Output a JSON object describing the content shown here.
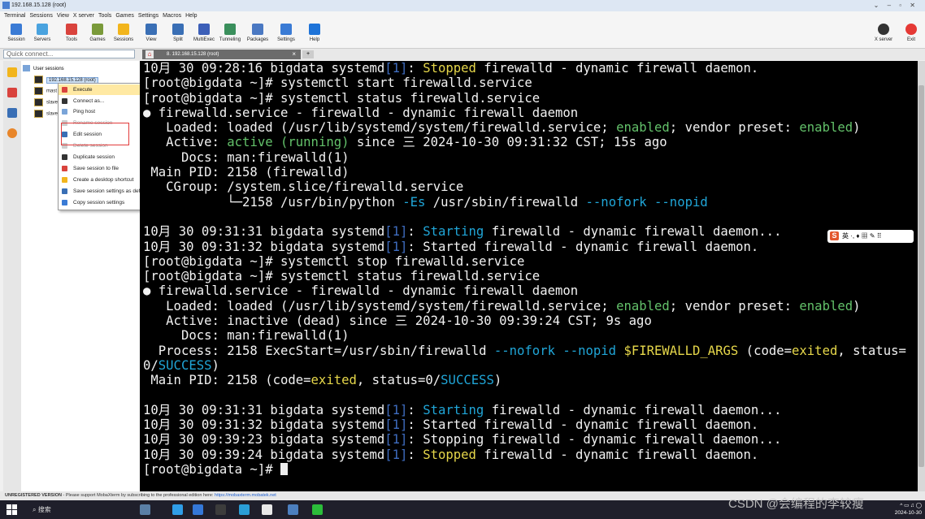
{
  "window": {
    "title": "192.168.15.128 (root)"
  },
  "menu": [
    "Terminal",
    "Sessions",
    "View",
    "X server",
    "Tools",
    "Games",
    "Settings",
    "Macros",
    "Help"
  ],
  "toolbar": {
    "left": [
      {
        "label": "Session",
        "icon": "session-icon",
        "color": "#3a7bd5"
      },
      {
        "label": "Servers",
        "icon": "servers-icon",
        "color": "#4aa3df"
      },
      {
        "label": "Tools",
        "icon": "tools-icon",
        "color": "#d9433d"
      },
      {
        "label": "Games",
        "icon": "games-icon",
        "color": "#7a9a3a"
      },
      {
        "label": "Sessions",
        "icon": "sessions-star-icon",
        "color": "#f2b51c"
      },
      {
        "label": "View",
        "icon": "view-icon",
        "color": "#3a6fb5"
      },
      {
        "label": "Split",
        "icon": "split-icon",
        "color": "#3a6fb5"
      },
      {
        "label": "MultiExec",
        "icon": "multiexec-icon",
        "color": "#3c5fb8"
      },
      {
        "label": "Tunneling",
        "icon": "tunneling-icon",
        "color": "#3a8f5c"
      },
      {
        "label": "Packages",
        "icon": "packages-icon",
        "color": "#4a78c2"
      },
      {
        "label": "Settings",
        "icon": "settings-icon",
        "color": "#3a7bd5"
      },
      {
        "label": "Help",
        "icon": "help-icon",
        "color": "#1e73d8"
      }
    ],
    "right": [
      {
        "label": "X server",
        "icon": "xserver-icon",
        "color": "#333333"
      },
      {
        "label": "Exit",
        "icon": "exit-icon",
        "color": "#e53935"
      }
    ]
  },
  "quick_connect": {
    "placeholder": "Quick connect..."
  },
  "tab": {
    "label": "8. 192.168.15.128 (root)",
    "close": "×"
  },
  "sidebar": {
    "root_label": "User sessions",
    "items": [
      "192.168.15.128 (root)",
      "mast",
      "slave",
      "slave"
    ]
  },
  "context_menu": [
    {
      "label": "Execute",
      "highlight": true,
      "disabled": false,
      "color": "#d9433d"
    },
    {
      "label": "Connect as...",
      "highlight": false,
      "disabled": false,
      "color": "#333333"
    },
    {
      "label": "Ping host",
      "highlight": false,
      "disabled": false,
      "color": "#7aa4d8"
    },
    {
      "label": "Rename session",
      "highlight": false,
      "disabled": true,
      "color": "#cccccc"
    },
    {
      "label": "Edit session",
      "highlight": false,
      "disabled": false,
      "color": "#3a6fb5"
    },
    {
      "label": "Delete session",
      "highlight": false,
      "disabled": true,
      "color": "#cccccc"
    },
    {
      "label": "Duplicate session",
      "highlight": false,
      "disabled": false,
      "color": "#333333"
    },
    {
      "label": "Save session to file",
      "highlight": false,
      "disabled": false,
      "color": "#d9433d"
    },
    {
      "label": "Create a desktop shortcut",
      "highlight": false,
      "disabled": false,
      "color": "#f2b51c"
    },
    {
      "label": "Save session settings as default presets",
      "highlight": false,
      "disabled": false,
      "color": "#3a6fb5"
    },
    {
      "label": "Copy session settings",
      "highlight": false,
      "disabled": false,
      "color": "#3a7bd5"
    }
  ],
  "terminal": {
    "lines": [
      [
        {
          "t": "10月 30 09:28:16 bigdata systemd"
        },
        {
          "t": "[1]",
          "c": "dim"
        },
        {
          "t": ": "
        },
        {
          "t": "Stopped",
          "c": "yellow"
        },
        {
          "t": " firewalld - dynamic firewall daemon."
        }
      ],
      [
        {
          "t": "[root@bigdata ~]# systemctl start firewalld.service"
        }
      ],
      [
        {
          "t": "[root@bigdata ~]# systemctl status firewalld.service"
        }
      ],
      [
        {
          "t": "● firewalld.service - firewalld - dynamic firewall daemon"
        }
      ],
      [
        {
          "t": "   Loaded: loaded (/usr/lib/systemd/system/firewalld.service; "
        },
        {
          "t": "enabled",
          "c": "green"
        },
        {
          "t": "; vendor preset: "
        },
        {
          "t": "enabled",
          "c": "green"
        },
        {
          "t": ")"
        }
      ],
      [
        {
          "t": "   Active: "
        },
        {
          "t": "active (running)",
          "c": "green"
        },
        {
          "t": " since 三 2024-10-30 09:31:32 CST; 15s ago"
        }
      ],
      [
        {
          "t": "     Docs: man:firewalld(1)"
        }
      ],
      [
        {
          "t": " Main PID: 2158 (firewalld)"
        }
      ],
      [
        {
          "t": "   CGroup: /system.slice/firewalld.service"
        }
      ],
      [
        {
          "t": "           └─2158 /usr/bin/python "
        },
        {
          "t": "-Es",
          "c": "cyan"
        },
        {
          "t": " /usr/sbin/firewalld "
        },
        {
          "t": "--nofork --nopid",
          "c": "cyan"
        }
      ],
      [
        {
          "t": ""
        }
      ],
      [
        {
          "t": "10月 30 09:31:31 bigdata systemd"
        },
        {
          "t": "[1]",
          "c": "dim"
        },
        {
          "t": ": "
        },
        {
          "t": "Starting",
          "c": "cyan"
        },
        {
          "t": " firewalld - dynamic firewall daemon..."
        }
      ],
      [
        {
          "t": "10月 30 09:31:32 bigdata systemd"
        },
        {
          "t": "[1]",
          "c": "dim"
        },
        {
          "t": ": Started firewalld - dynamic firewall daemon."
        }
      ],
      [
        {
          "t": "[root@bigdata ~]# systemctl stop firewalld.service"
        }
      ],
      [
        {
          "t": "[root@bigdata ~]# systemctl status firewalld.service"
        }
      ],
      [
        {
          "t": "● firewalld.service - firewalld - dynamic firewall daemon"
        }
      ],
      [
        {
          "t": "   Loaded: loaded (/usr/lib/systemd/system/firewalld.service; "
        },
        {
          "t": "enabled",
          "c": "green"
        },
        {
          "t": "; vendor preset: "
        },
        {
          "t": "enabled",
          "c": "green"
        },
        {
          "t": ")"
        }
      ],
      [
        {
          "t": "   Active: inactive (dead) since 三 2024-10-30 09:39:24 CST; 9s ago"
        }
      ],
      [
        {
          "t": "     Docs: man:firewalld(1)"
        }
      ],
      [
        {
          "t": "  Process: 2158 ExecStart=/usr/sbin/firewalld "
        },
        {
          "t": "--nofork --nopid",
          "c": "cyan"
        },
        {
          "t": " $FIREWALLD_ARGS",
          "c": "yellow"
        },
        {
          "t": " (code="
        },
        {
          "t": "exited",
          "c": "yellow"
        },
        {
          "t": ", status="
        }
      ],
      [
        {
          "t": "0/"
        },
        {
          "t": "SUCCESS",
          "c": "cyan"
        },
        {
          "t": ")"
        }
      ],
      [
        {
          "t": " Main PID: 2158 (code="
        },
        {
          "t": "exited",
          "c": "yellow"
        },
        {
          "t": ", status=0/"
        },
        {
          "t": "SUCCESS",
          "c": "cyan"
        },
        {
          "t": ")"
        }
      ],
      [
        {
          "t": ""
        }
      ],
      [
        {
          "t": "10月 30 09:31:31 bigdata systemd"
        },
        {
          "t": "[1]",
          "c": "dim"
        },
        {
          "t": ": "
        },
        {
          "t": "Starting",
          "c": "cyan"
        },
        {
          "t": " firewalld - dynamic firewall daemon..."
        }
      ],
      [
        {
          "t": "10月 30 09:31:32 bigdata systemd"
        },
        {
          "t": "[1]",
          "c": "dim"
        },
        {
          "t": ": Started firewalld - dynamic firewall daemon."
        }
      ],
      [
        {
          "t": "10月 30 09:39:23 bigdata systemd"
        },
        {
          "t": "[1]",
          "c": "dim"
        },
        {
          "t": ": Stopping firewalld - dynamic firewall daemon..."
        }
      ],
      [
        {
          "t": "10月 30 09:39:24 bigdata systemd"
        },
        {
          "t": "[1]",
          "c": "dim"
        },
        {
          "t": ": "
        },
        {
          "t": "Stopped",
          "c": "yellow"
        },
        {
          "t": " firewalld - dynamic firewall daemon."
        }
      ],
      [
        {
          "t": "[root@bigdata ~]# "
        }
      ]
    ]
  },
  "ime": {
    "text": "英 ·, ♦ ▦ ✎ ⠿",
    "logo": "S"
  },
  "status_bar": {
    "prefix": "UNREGISTERED VERSION",
    "text": "  -  Please support MobaXterm by subscribing to the professional edition here:  ",
    "link": "https://mobaxterm.mobatek.net"
  },
  "taskbar": {
    "search_label": "搜索",
    "apps": [
      {
        "icon": "game-app-icon",
        "color": "#5a7fa6"
      },
      {
        "icon": "edge-icon",
        "color": "#2f9ee8"
      },
      {
        "icon": "file-explorer-icon",
        "color": "#3478d8"
      },
      {
        "icon": "typora-icon",
        "color": "#3c3c3c"
      },
      {
        "icon": "vmware-icon",
        "color": "#2a9ed6"
      },
      {
        "icon": "mail-icon",
        "color": "#e8e8e8"
      },
      {
        "icon": "mobaxterm-icon",
        "color": "#4c7fbf"
      },
      {
        "icon": "wechat-icon",
        "color": "#2bbd3a"
      }
    ],
    "date": "2024-10-30"
  },
  "watermark": "CSDN @会编程的李较瘦"
}
